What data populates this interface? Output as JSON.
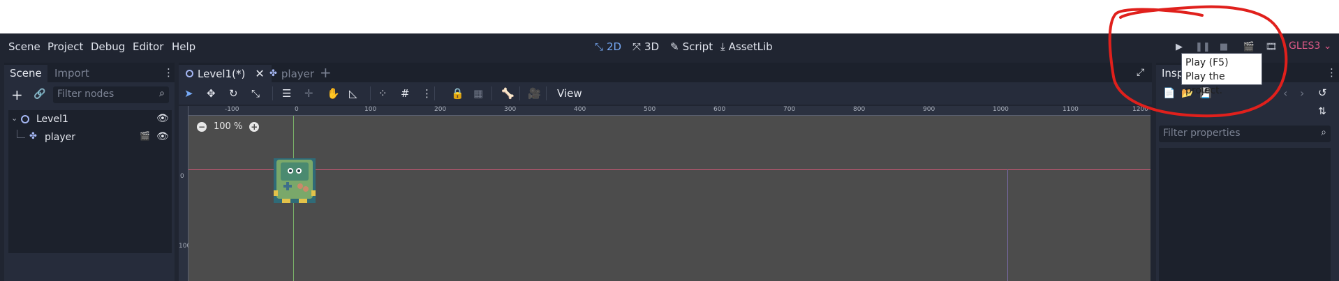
{
  "menubar": {
    "items": [
      "Scene",
      "Project",
      "Debug",
      "Editor",
      "Help"
    ],
    "workspaces": [
      {
        "label": "2D",
        "icon": "2d-icon",
        "active": true
      },
      {
        "label": "3D",
        "icon": "3d-icon",
        "active": false
      },
      {
        "label": "Script",
        "icon": "script-icon",
        "active": false
      },
      {
        "label": "AssetLib",
        "icon": "assetlib-icon",
        "active": false
      }
    ],
    "renderer": "GLES3 ⌄"
  },
  "tooltip": {
    "title": "Play (F5)",
    "description": "Play the project."
  },
  "scene_dock": {
    "tabs": [
      "Scene",
      "Import"
    ],
    "filter_placeholder": "Filter nodes",
    "tree": [
      {
        "label": "Level1",
        "icon": "node2d-icon"
      },
      {
        "label": "player",
        "icon": "kinematic-body-icon"
      }
    ]
  },
  "main_tabs": [
    {
      "label": "Level1(*)",
      "active": true
    },
    {
      "label": "player",
      "active": false
    }
  ],
  "viewport": {
    "view_menu": "View",
    "zoom": "100 %",
    "ruler_top": [
      "-100",
      "0",
      "100",
      "200",
      "300",
      "400",
      "500",
      "600",
      "700",
      "800",
      "900",
      "1000",
      "1100",
      "1200"
    ],
    "ruler_left": [
      "0",
      "100"
    ]
  },
  "inspector": {
    "tab": "Insp",
    "filter_placeholder": "Filter properties"
  },
  "colors": {
    "editor_bg": "#202531",
    "panel_bg": "#262c3b",
    "accent": "#76a9f5",
    "renderer": "#e05a88",
    "annotation": "#e0201c"
  }
}
